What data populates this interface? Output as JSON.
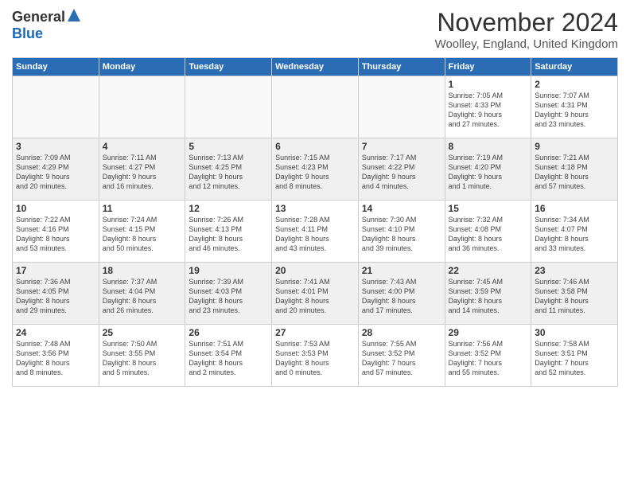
{
  "header": {
    "logo_general": "General",
    "logo_blue": "Blue",
    "month_title": "November 2024",
    "location": "Woolley, England, United Kingdom"
  },
  "days_of_week": [
    "Sunday",
    "Monday",
    "Tuesday",
    "Wednesday",
    "Thursday",
    "Friday",
    "Saturday"
  ],
  "weeks": [
    [
      {
        "day": "",
        "info": ""
      },
      {
        "day": "",
        "info": ""
      },
      {
        "day": "",
        "info": ""
      },
      {
        "day": "",
        "info": ""
      },
      {
        "day": "",
        "info": ""
      },
      {
        "day": "1",
        "info": "Sunrise: 7:05 AM\nSunset: 4:33 PM\nDaylight: 9 hours\nand 27 minutes."
      },
      {
        "day": "2",
        "info": "Sunrise: 7:07 AM\nSunset: 4:31 PM\nDaylight: 9 hours\nand 23 minutes."
      }
    ],
    [
      {
        "day": "3",
        "info": "Sunrise: 7:09 AM\nSunset: 4:29 PM\nDaylight: 9 hours\nand 20 minutes."
      },
      {
        "day": "4",
        "info": "Sunrise: 7:11 AM\nSunset: 4:27 PM\nDaylight: 9 hours\nand 16 minutes."
      },
      {
        "day": "5",
        "info": "Sunrise: 7:13 AM\nSunset: 4:25 PM\nDaylight: 9 hours\nand 12 minutes."
      },
      {
        "day": "6",
        "info": "Sunrise: 7:15 AM\nSunset: 4:23 PM\nDaylight: 9 hours\nand 8 minutes."
      },
      {
        "day": "7",
        "info": "Sunrise: 7:17 AM\nSunset: 4:22 PM\nDaylight: 9 hours\nand 4 minutes."
      },
      {
        "day": "8",
        "info": "Sunrise: 7:19 AM\nSunset: 4:20 PM\nDaylight: 9 hours\nand 1 minute."
      },
      {
        "day": "9",
        "info": "Sunrise: 7:21 AM\nSunset: 4:18 PM\nDaylight: 8 hours\nand 57 minutes."
      }
    ],
    [
      {
        "day": "10",
        "info": "Sunrise: 7:22 AM\nSunset: 4:16 PM\nDaylight: 8 hours\nand 53 minutes."
      },
      {
        "day": "11",
        "info": "Sunrise: 7:24 AM\nSunset: 4:15 PM\nDaylight: 8 hours\nand 50 minutes."
      },
      {
        "day": "12",
        "info": "Sunrise: 7:26 AM\nSunset: 4:13 PM\nDaylight: 8 hours\nand 46 minutes."
      },
      {
        "day": "13",
        "info": "Sunrise: 7:28 AM\nSunset: 4:11 PM\nDaylight: 8 hours\nand 43 minutes."
      },
      {
        "day": "14",
        "info": "Sunrise: 7:30 AM\nSunset: 4:10 PM\nDaylight: 8 hours\nand 39 minutes."
      },
      {
        "day": "15",
        "info": "Sunrise: 7:32 AM\nSunset: 4:08 PM\nDaylight: 8 hours\nand 36 minutes."
      },
      {
        "day": "16",
        "info": "Sunrise: 7:34 AM\nSunset: 4:07 PM\nDaylight: 8 hours\nand 33 minutes."
      }
    ],
    [
      {
        "day": "17",
        "info": "Sunrise: 7:36 AM\nSunset: 4:05 PM\nDaylight: 8 hours\nand 29 minutes."
      },
      {
        "day": "18",
        "info": "Sunrise: 7:37 AM\nSunset: 4:04 PM\nDaylight: 8 hours\nand 26 minutes."
      },
      {
        "day": "19",
        "info": "Sunrise: 7:39 AM\nSunset: 4:03 PM\nDaylight: 8 hours\nand 23 minutes."
      },
      {
        "day": "20",
        "info": "Sunrise: 7:41 AM\nSunset: 4:01 PM\nDaylight: 8 hours\nand 20 minutes."
      },
      {
        "day": "21",
        "info": "Sunrise: 7:43 AM\nSunset: 4:00 PM\nDaylight: 8 hours\nand 17 minutes."
      },
      {
        "day": "22",
        "info": "Sunrise: 7:45 AM\nSunset: 3:59 PM\nDaylight: 8 hours\nand 14 minutes."
      },
      {
        "day": "23",
        "info": "Sunrise: 7:46 AM\nSunset: 3:58 PM\nDaylight: 8 hours\nand 11 minutes."
      }
    ],
    [
      {
        "day": "24",
        "info": "Sunrise: 7:48 AM\nSunset: 3:56 PM\nDaylight: 8 hours\nand 8 minutes."
      },
      {
        "day": "25",
        "info": "Sunrise: 7:50 AM\nSunset: 3:55 PM\nDaylight: 8 hours\nand 5 minutes."
      },
      {
        "day": "26",
        "info": "Sunrise: 7:51 AM\nSunset: 3:54 PM\nDaylight: 8 hours\nand 2 minutes."
      },
      {
        "day": "27",
        "info": "Sunrise: 7:53 AM\nSunset: 3:53 PM\nDaylight: 8 hours\nand 0 minutes."
      },
      {
        "day": "28",
        "info": "Sunrise: 7:55 AM\nSunset: 3:52 PM\nDaylight: 7 hours\nand 57 minutes."
      },
      {
        "day": "29",
        "info": "Sunrise: 7:56 AM\nSunset: 3:52 PM\nDaylight: 7 hours\nand 55 minutes."
      },
      {
        "day": "30",
        "info": "Sunrise: 7:58 AM\nSunset: 3:51 PM\nDaylight: 7 hours\nand 52 minutes."
      }
    ]
  ]
}
